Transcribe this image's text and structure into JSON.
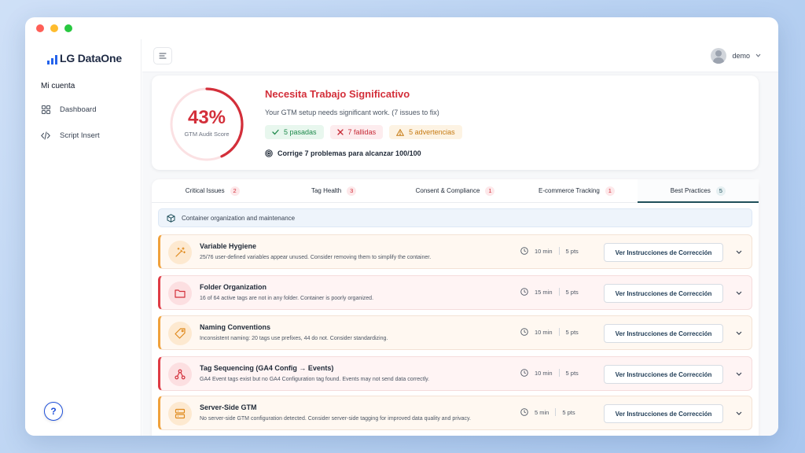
{
  "app": {
    "logo_text": "LG DataOne"
  },
  "sidebar": {
    "section_title": "Mi cuenta",
    "items": [
      {
        "label": "Dashboard",
        "icon": "grid-icon"
      },
      {
        "label": "Script Insert",
        "icon": "code-icon"
      }
    ],
    "help_label": "?"
  },
  "topbar": {
    "user_name": "demo"
  },
  "score": {
    "percent_text": "43%",
    "percent_value": 43,
    "label": "GTM Audit Score",
    "title": "Necesita Trabajo Significativo",
    "subtitle": "Your GTM setup needs significant work. (7 issues to fix)",
    "badges": {
      "pass": "5 pasadas",
      "fail": "7 fallidas",
      "warn": "5 advertencias"
    },
    "hint": "Corrige 7 problemas para alcanzar 100/100",
    "colors": {
      "accent_red": "#d32f3a",
      "track": "#fbe1e3"
    }
  },
  "tabs": [
    {
      "label": "Critical Issues",
      "count": "2"
    },
    {
      "label": "Tag Health",
      "count": "3"
    },
    {
      "label": "Consent & Compliance",
      "count": "1"
    },
    {
      "label": "E-commerce Tracking",
      "count": "1"
    },
    {
      "label": "Best Practices",
      "count": "5"
    }
  ],
  "section": {
    "label": "Container organization and maintenance"
  },
  "fix_button_label": "Ver Instrucciones de Corrección",
  "issues": [
    {
      "title": "Variable Hygiene",
      "description": "25/76 user-defined variables appear unused. Consider removing them to simplify the container.",
      "time": "10 min",
      "points": "5 pts",
      "severity": "warning",
      "icon": "magic-wand-icon"
    },
    {
      "title": "Folder Organization",
      "description": "16 of 64 active tags are not in any folder. Container is poorly organized.",
      "time": "15 min",
      "points": "5 pts",
      "severity": "error",
      "icon": "folder-icon"
    },
    {
      "title": "Naming Conventions",
      "description": "Inconsistent naming: 20 tags use prefixes, 44 do not. Consider standardizing.",
      "time": "10 min",
      "points": "5 pts",
      "severity": "warning",
      "icon": "tag-icon"
    },
    {
      "title": "Tag Sequencing (GA4 Config → Events)",
      "description": "GA4 Event tags exist but no GA4 Configuration tag found. Events may not send data correctly.",
      "time": "10 min",
      "points": "5 pts",
      "severity": "error",
      "icon": "network-icon"
    },
    {
      "title": "Server-Side GTM",
      "description": "No server-side GTM configuration detected. Consider server-side tagging for improved data quality and privacy.",
      "time": "5 min",
      "points": "5 pts",
      "severity": "warning",
      "icon": "server-icon"
    }
  ]
}
